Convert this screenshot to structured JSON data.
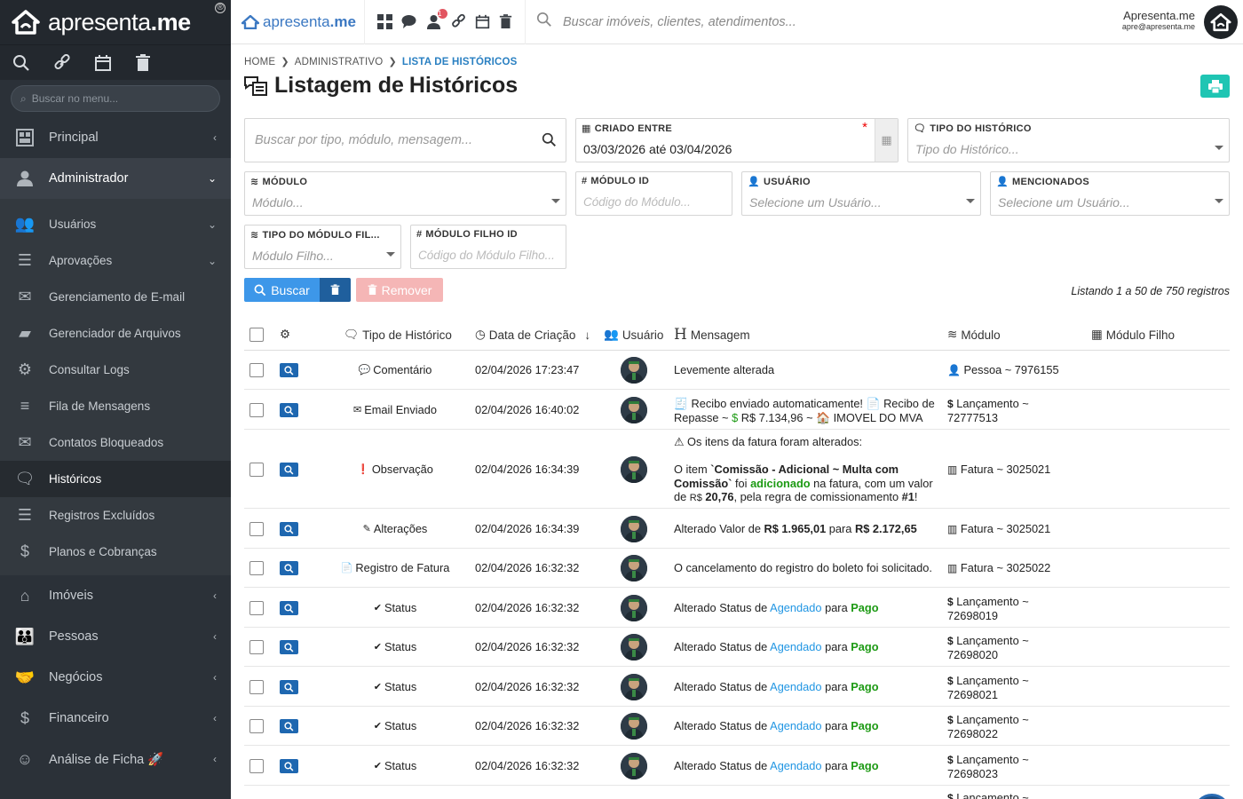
{
  "brand": {
    "name_light": "apresenta",
    "name_bold": ".me"
  },
  "sidebar": {
    "search_placeholder": "Buscar no menu...",
    "groups": [
      {
        "label": "Principal"
      },
      {
        "label": "Administrador"
      }
    ],
    "sub_items": [
      {
        "label": "Usuários"
      },
      {
        "label": "Aprovações"
      },
      {
        "label": "Gerenciamento de E-mail"
      },
      {
        "label": "Gerenciador de Arquivos"
      },
      {
        "label": "Consultar Logs"
      },
      {
        "label": "Fila de Mensagens"
      },
      {
        "label": "Contatos Bloqueados"
      },
      {
        "label": "Históricos"
      },
      {
        "label": "Registros Excluídos"
      },
      {
        "label": "Planos e Cobranças"
      }
    ],
    "bottom_groups": [
      {
        "label": "Imóveis"
      },
      {
        "label": "Pessoas"
      },
      {
        "label": "Negócios"
      },
      {
        "label": "Financeiro"
      },
      {
        "label": "Análise de Ficha 🚀"
      }
    ]
  },
  "topbar": {
    "search_placeholder": "Buscar imóveis, clientes, atendimentos...",
    "notification_count": "1",
    "user_name": "Apresenta.me",
    "user_email": "apre@apresenta.me"
  },
  "breadcrumb": {
    "home": "HOME",
    "admin": "ADMINISTRATIVO",
    "current": "LISTA DE HISTÓRICOS"
  },
  "page": {
    "title_light": "Listagem de",
    "title_bold": "Históricos"
  },
  "filters": {
    "search_placeholder": "Buscar por tipo, módulo, mensagem...",
    "criado_entre": {
      "label": "CRIADO ENTRE",
      "value": "03/03/2026 até 03/04/2026"
    },
    "tipo_historico": {
      "label": "TIPO DO HISTÓRICO",
      "placeholder": "Tipo do Histórico..."
    },
    "modulo": {
      "label": "MÓDULO",
      "placeholder": "Módulo..."
    },
    "modulo_id": {
      "label": "MÓDULO ID",
      "placeholder": "Código do Módulo..."
    },
    "usuario": {
      "label": "USUÁRIO",
      "placeholder": "Selecione um Usuário..."
    },
    "mencionados": {
      "label": "MENCIONADOS",
      "placeholder": "Selecione um Usuário..."
    },
    "tipo_modulo_filho": {
      "label": "TIPO DO MÓDULO FIL...",
      "placeholder": "Módulo Filho..."
    },
    "modulo_filho_id": {
      "label": "MÓDULO FILHO ID",
      "placeholder": "Código do Módulo Filho..."
    }
  },
  "actions": {
    "search_label": "Buscar",
    "remove_label": "Remover",
    "listing_info": "Listando 1 a 50 de 750 registros"
  },
  "table": {
    "headers": {
      "tipo": "Tipo de Histórico",
      "data": "Data de Criação",
      "usuario": "Usuário",
      "mensagem": "Mensagem",
      "modulo": "Módulo",
      "modulo_filho": "Módulo Filho"
    },
    "rows": [
      {
        "tipo": "Comentário",
        "data": "02/04/2026 17:23:47",
        "modulo": "Pessoa ~ 7976155"
      },
      {
        "tipo": "Email Enviado",
        "data": "02/04/2026 16:40:02",
        "modulo_l1": "Lançamento ~",
        "modulo_l2": "72777513"
      },
      {
        "tipo": "Observação",
        "data": "02/04/2026 16:34:39",
        "modulo": "Fatura ~ 3025021"
      },
      {
        "tipo": "Alterações",
        "data": "02/04/2026 16:34:39",
        "modulo": "Fatura ~ 3025021"
      },
      {
        "tipo": "Registro de Fatura",
        "data": "02/04/2026 16:32:32",
        "modulo": "Fatura ~ 3025022"
      },
      {
        "tipo": "Status",
        "data": "02/04/2026 16:32:32",
        "modulo_l1": "Lançamento ~",
        "modulo_l2": "72698019"
      },
      {
        "tipo": "Status",
        "data": "02/04/2026 16:32:32",
        "modulo_l1": "Lançamento ~",
        "modulo_l2": "72698020"
      },
      {
        "tipo": "Status",
        "data": "02/04/2026 16:32:32",
        "modulo_l1": "Lançamento ~",
        "modulo_l2": "72698021"
      },
      {
        "tipo": "Status",
        "data": "02/04/2026 16:32:32",
        "modulo_l1": "Lançamento ~",
        "modulo_l2": "72698022"
      },
      {
        "tipo": "Status",
        "data": "02/04/2026 16:32:32",
        "modulo_l1": "Lançamento ~",
        "modulo_l2": "72698023"
      },
      {
        "modulo_l1": "Lançamento ~"
      }
    ],
    "messages": {
      "r0": "Levemente alterada",
      "r1_a": "Recibo enviado automaticamente!",
      "r1_b": "Recibo de Repasse ~",
      "r1_c": "R$ 7.134,96 ~",
      "r1_d": "IMOVEL DO MVA",
      "r2_a": "Os itens da fatura foram alterados:",
      "r2_b": "O item",
      "r2_c": "`Comissão - Adicional ~ Multa com Comissão`",
      "r2_d": "foi",
      "r2_e": "adicionado",
      "r2_f": "na fatura, com um valor de",
      "r2_g": "R$",
      "r2_h": "20,76",
      "r2_i": ", pela regra de comissionamento",
      "r2_j": "#1",
      "r2_k": "!",
      "r3_a": "Alterado Valor de",
      "r3_b": "R$ 1.965,01",
      "r3_c": "para",
      "r3_d": "R$ 2.172,65",
      "r4": "O cancelamento do registro do boleto foi solicitado.",
      "status_a": "Alterado Status de",
      "status_b": "Agendado",
      "status_c": "para",
      "status_d": "Pago"
    }
  },
  "colors": {
    "accent": "#2a80c2",
    "teal": "#1fc5b3",
    "sidebar": "#2b3138",
    "danger_soft": "#f5b6b6"
  }
}
